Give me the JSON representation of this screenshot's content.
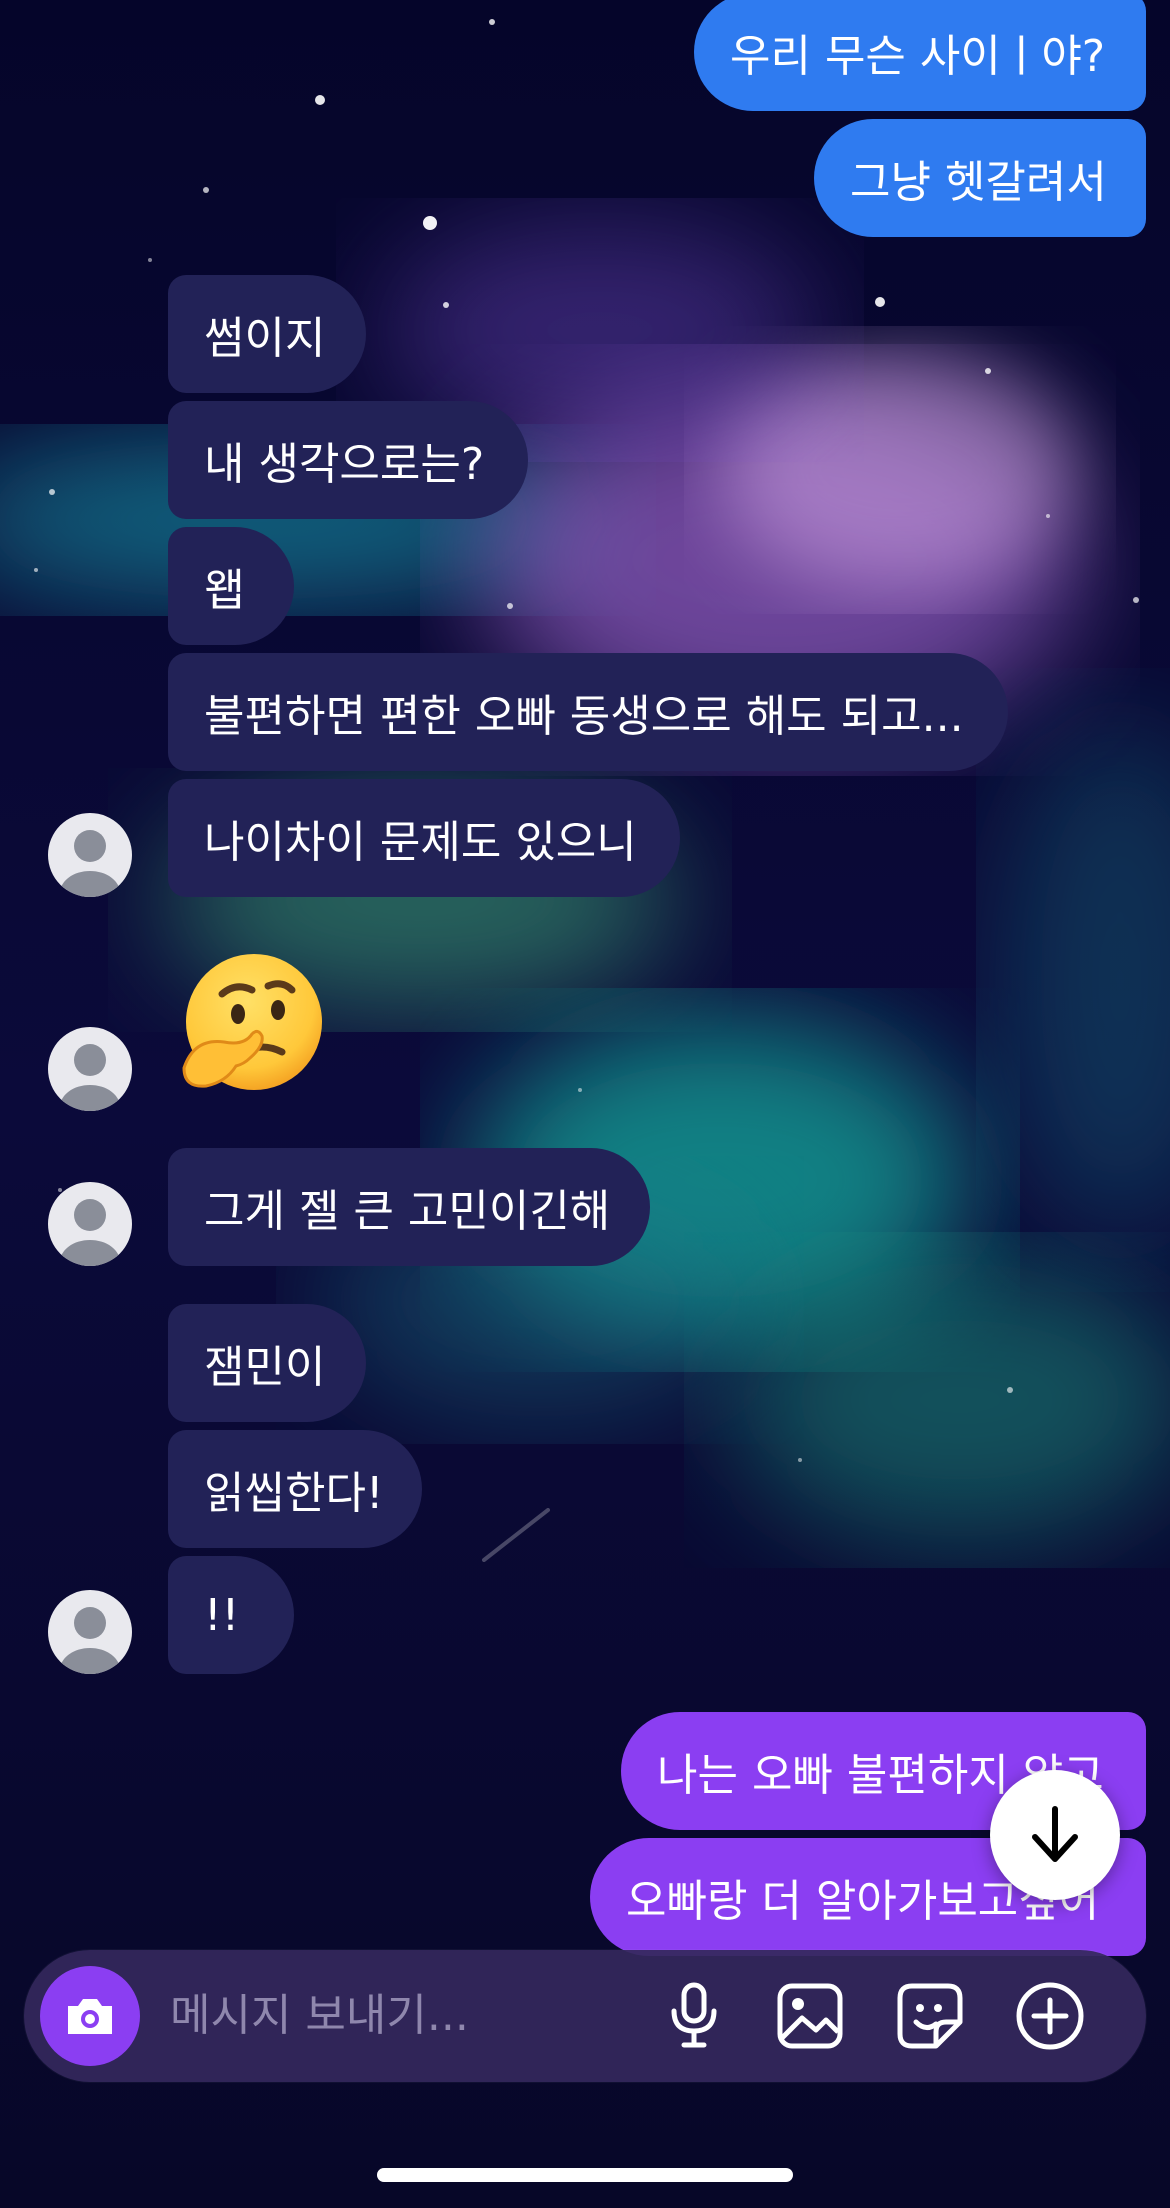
{
  "theme": {
    "incoming_bubble": "#222257",
    "outgoing_blue": "#2f7bf0",
    "outgoing_purple": "#8b3ef2",
    "background": "#07072a"
  },
  "messages": [
    {
      "side": "out",
      "text": "우리 무슨 사이ㅣ야?",
      "color": "#2f7bf0"
    },
    {
      "side": "out",
      "text": "그냥 헷갈려서",
      "color": "#2f7bf0"
    },
    {
      "side": "in",
      "text": "썸이지"
    },
    {
      "side": "in",
      "text": "내 생각으로는?"
    },
    {
      "side": "in",
      "text": "왭"
    },
    {
      "side": "in",
      "text": "불편하면 편한 오빠 동생으로 해도 되고..."
    },
    {
      "side": "in",
      "text": "나이차이 문제도 있으니"
    },
    {
      "side": "in",
      "text": "🤔",
      "type": "emoji",
      "emoji_name": "thinking-face-emoji"
    },
    {
      "side": "in",
      "text": "그게 젤 큰 고민이긴해"
    },
    {
      "side": "in",
      "text": "잼민이"
    },
    {
      "side": "in",
      "text": "읽씹한다!"
    },
    {
      "side": "in",
      "text": "!!"
    },
    {
      "side": "out",
      "text": "나는 오빠 불편하지 않고",
      "color": "#8b3ef2"
    },
    {
      "side": "out",
      "text": "오빠랑 더 알아가보고싶어",
      "color": "#8b3ef2"
    }
  ],
  "composer": {
    "placeholder": "메시지 보내기...",
    "camera_icon": "camera-icon",
    "mic_icon": "microphone-icon",
    "gallery_icon": "gallery-icon",
    "sticker_icon": "sticker-icon",
    "plus_icon": "plus-circle-icon"
  },
  "scroll_button_icon": "arrow-down-icon"
}
